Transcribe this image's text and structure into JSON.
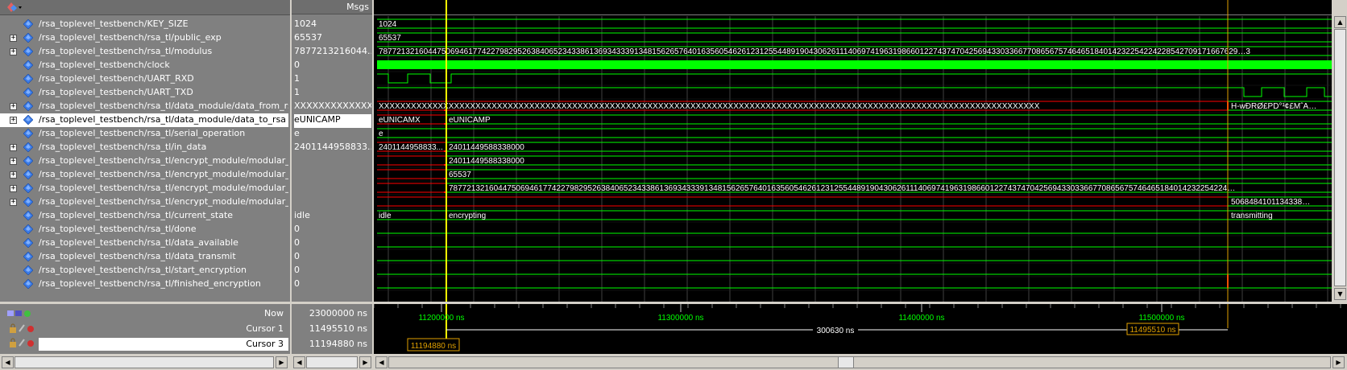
{
  "panes": {
    "values_header": "Msgs"
  },
  "signals": [
    {
      "name": "/rsa_toplevel_testbench/KEY_SIZE",
      "value": "1024",
      "expandable": false
    },
    {
      "name": "/rsa_toplevel_testbench/rsa_tl/public_exp",
      "value": "65537",
      "expandable": true
    },
    {
      "name": "/rsa_toplevel_testbench/rsa_tl/modulus",
      "value": "7877213216044...",
      "expandable": true
    },
    {
      "name": "/rsa_toplevel_testbench/clock",
      "value": "0",
      "expandable": false
    },
    {
      "name": "/rsa_toplevel_testbench/UART_RXD",
      "value": "1",
      "expandable": false
    },
    {
      "name": "/rsa_toplevel_testbench/UART_TXD",
      "value": "1",
      "expandable": false
    },
    {
      "name": "/rsa_toplevel_testbench/rsa_tl/data_module/data_from_rsa",
      "value": "XXXXXXXXXXXXX...",
      "expandable": true
    },
    {
      "name": "/rsa_toplevel_testbench/rsa_tl/data_module/data_to_rsa",
      "value": "eUNICAMP",
      "expandable": true,
      "selected": true
    },
    {
      "name": "/rsa_toplevel_testbench/rsa_tl/serial_operation",
      "value": "e",
      "expandable": false
    },
    {
      "name": "/rsa_toplevel_testbench/rsa_tl/in_data",
      "value": "2401144958833...",
      "expandable": true
    },
    {
      "name": "/rsa_toplevel_testbench/rsa_tl/encrypt_module/modular_exp/A",
      "value": "",
      "expandable": true
    },
    {
      "name": "/rsa_toplevel_testbench/rsa_tl/encrypt_module/modular_exp/b",
      "value": "",
      "expandable": true
    },
    {
      "name": "/rsa_toplevel_testbench/rsa_tl/encrypt_module/modular_exp/C",
      "value": "",
      "expandable": true
    },
    {
      "name": "/rsa_toplevel_testbench/rsa_tl/encrypt_module/modular_exp/R",
      "value": "",
      "expandable": true
    },
    {
      "name": "/rsa_toplevel_testbench/rsa_tl/current_state",
      "value": "idle",
      "expandable": false
    },
    {
      "name": "/rsa_toplevel_testbench/rsa_tl/done",
      "value": "0",
      "expandable": false
    },
    {
      "name": "/rsa_toplevel_testbench/rsa_tl/data_available",
      "value": "0",
      "expandable": false
    },
    {
      "name": "/rsa_toplevel_testbench/rsa_tl/data_transmit",
      "value": "0",
      "expandable": false
    },
    {
      "name": "/rsa_toplevel_testbench/rsa_tl/start_encryption",
      "value": "0",
      "expandable": false
    },
    {
      "name": "/rsa_toplevel_testbench/rsa_tl/finished_encryption",
      "value": "0",
      "expandable": false
    }
  ],
  "waves": {
    "key_size": "1024",
    "public_exp": "65537",
    "modulus": "787721321604475069461774227982952638406523433861369343339134815626576401635605462612312554489190430626111406974196319866012274374704256943303366770865675746465184014232254224228542709171667629…3",
    "data_from_rsa_x": "XXXXXXXXXXXXXXXXXXXXXXXXXXXXXXXXXXXXXXXXXXXXXXXXXXXXXXXXXXXXXXXXXXXXXXXXXXXXXXXXXXXXXXXXXXXXXXXXXXXXXXXXXXXXXXXXXXXXXXXXXXX",
    "data_from_rsa_after": "H-wĐRØ£PD°¹¢£MˆA…",
    "data_to_rsa_before": "eUNICAMX",
    "data_to_rsa_after": "eUNICAMP",
    "serial_operation": "e",
    "in_data_before": "2401144958833...",
    "in_data_after": "24011449588338000",
    "modexp_a": "24011449588338000",
    "modexp_b": "65537",
    "modexp_c": "787721321604475069461774227982952638406523433861369343339134815626576401635605462612312554489190430626111406974196319866012274374704256943303366770865675746465184014232254224…",
    "modexp_r": "5068484101134338…",
    "state_idle": "idle",
    "state_encrypting": "encrypting",
    "state_transmitting": "transmitting"
  },
  "bottom": {
    "now_label": "Now",
    "now_value": "23000000 ns",
    "cursor1_label": "Cursor 1",
    "cursor1_value": "11495510 ns",
    "cursor3_label": "Cursor 3",
    "cursor3_value": "11194880 ns",
    "tick_labels": [
      "11200000 ns",
      "11300000 ns",
      "11400000 ns",
      "11500000 ns"
    ],
    "delta": "300630 ns",
    "cursor1_flag": "11495510 ns",
    "cursor3_flag": "11194880 ns"
  },
  "colors": {
    "wave_green": "#00ff00",
    "undefined_red": "#ff0000",
    "cursor_yellow": "#ffff00",
    "cursor_gold": "#e0a000",
    "grid": "#404040"
  }
}
